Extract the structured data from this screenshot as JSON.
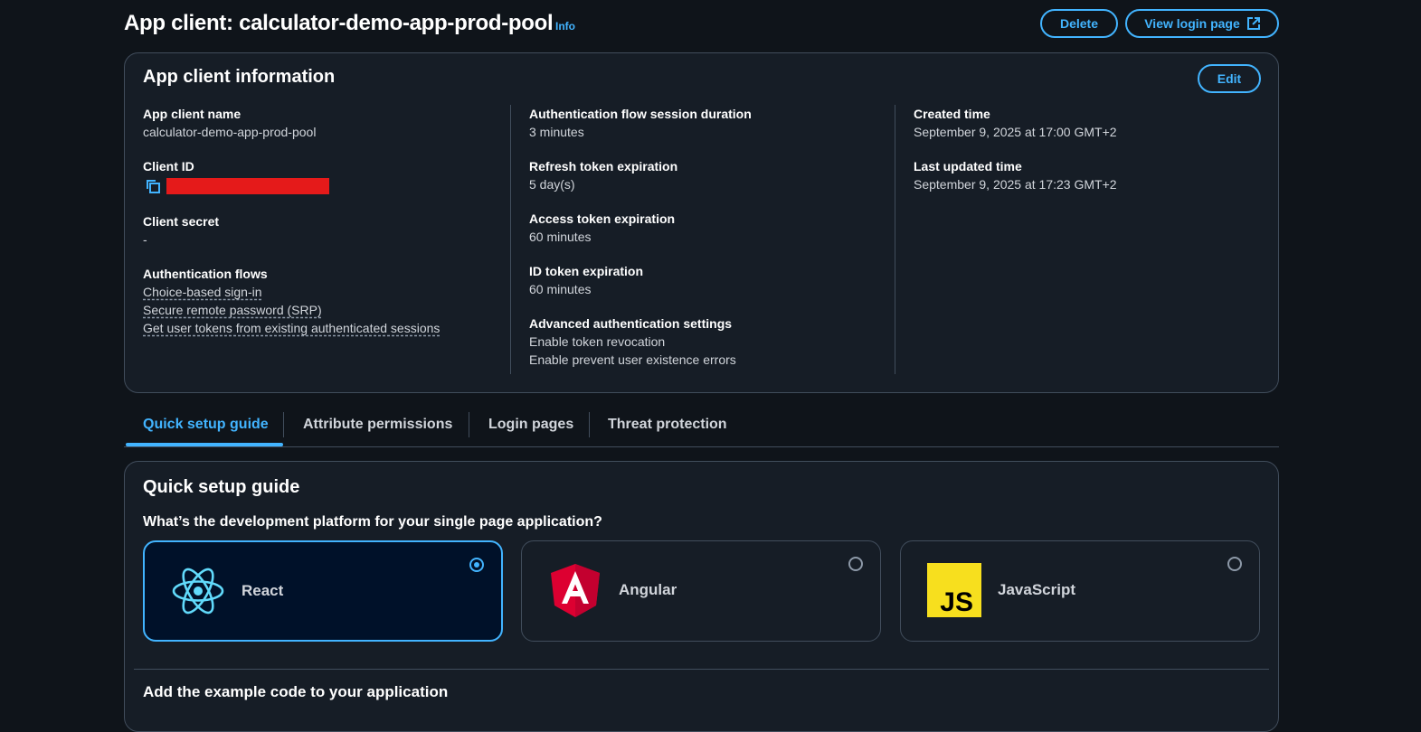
{
  "header": {
    "title": "App client: calculator-demo-app-prod-pool",
    "info_label": "Info",
    "delete_label": "Delete",
    "view_login_label": "View login page"
  },
  "app_client_info": {
    "title": "App client information",
    "edit_label": "Edit",
    "col1": {
      "name_label": "App client name",
      "name_value": "calculator-demo-app-prod-pool",
      "client_id_label": "Client ID",
      "client_secret_label": "Client secret",
      "client_secret_value": "-",
      "auth_flows_label": "Authentication flows",
      "auth_flows": [
        "Choice-based sign-in",
        "Secure remote password (SRP)",
        "Get user tokens from existing authenticated sessions"
      ]
    },
    "col2": {
      "session_label": "Authentication flow session duration",
      "session_value": "3 minutes",
      "refresh_label": "Refresh token expiration",
      "refresh_value": "5 day(s)",
      "access_label": "Access token expiration",
      "access_value": "60 minutes",
      "id_label": "ID token expiration",
      "id_value": "60 minutes",
      "advanced_label": "Advanced authentication settings",
      "advanced_values": [
        "Enable token revocation",
        "Enable prevent user existence errors"
      ]
    },
    "col3": {
      "created_label": "Created time",
      "created_value": "September 9, 2025 at 17:00 GMT+2",
      "updated_label": "Last updated time",
      "updated_value": "September 9, 2025 at 17:23 GMT+2"
    }
  },
  "tabs": [
    {
      "label": "Quick setup guide",
      "active": true
    },
    {
      "label": "Attribute permissions",
      "active": false
    },
    {
      "label": "Login pages",
      "active": false
    },
    {
      "label": "Threat protection",
      "active": false
    }
  ],
  "guide": {
    "title": "Quick setup guide",
    "question": "What’s the development platform for your single page application?",
    "options": [
      {
        "label": "React",
        "selected": true
      },
      {
        "label": "Angular",
        "selected": false
      },
      {
        "label": "JavaScript",
        "selected": false
      }
    ],
    "js_logo_text": "JS",
    "next_section": "Add the example code to your application"
  },
  "colors": {
    "accent": "#42b4ff",
    "background": "#0f141a",
    "panel": "#161d26",
    "border": "#414d5c",
    "redaction": "#e51a1a",
    "react": "#61dafb",
    "angular": "#dd0031",
    "javascript": "#f7df1e"
  }
}
